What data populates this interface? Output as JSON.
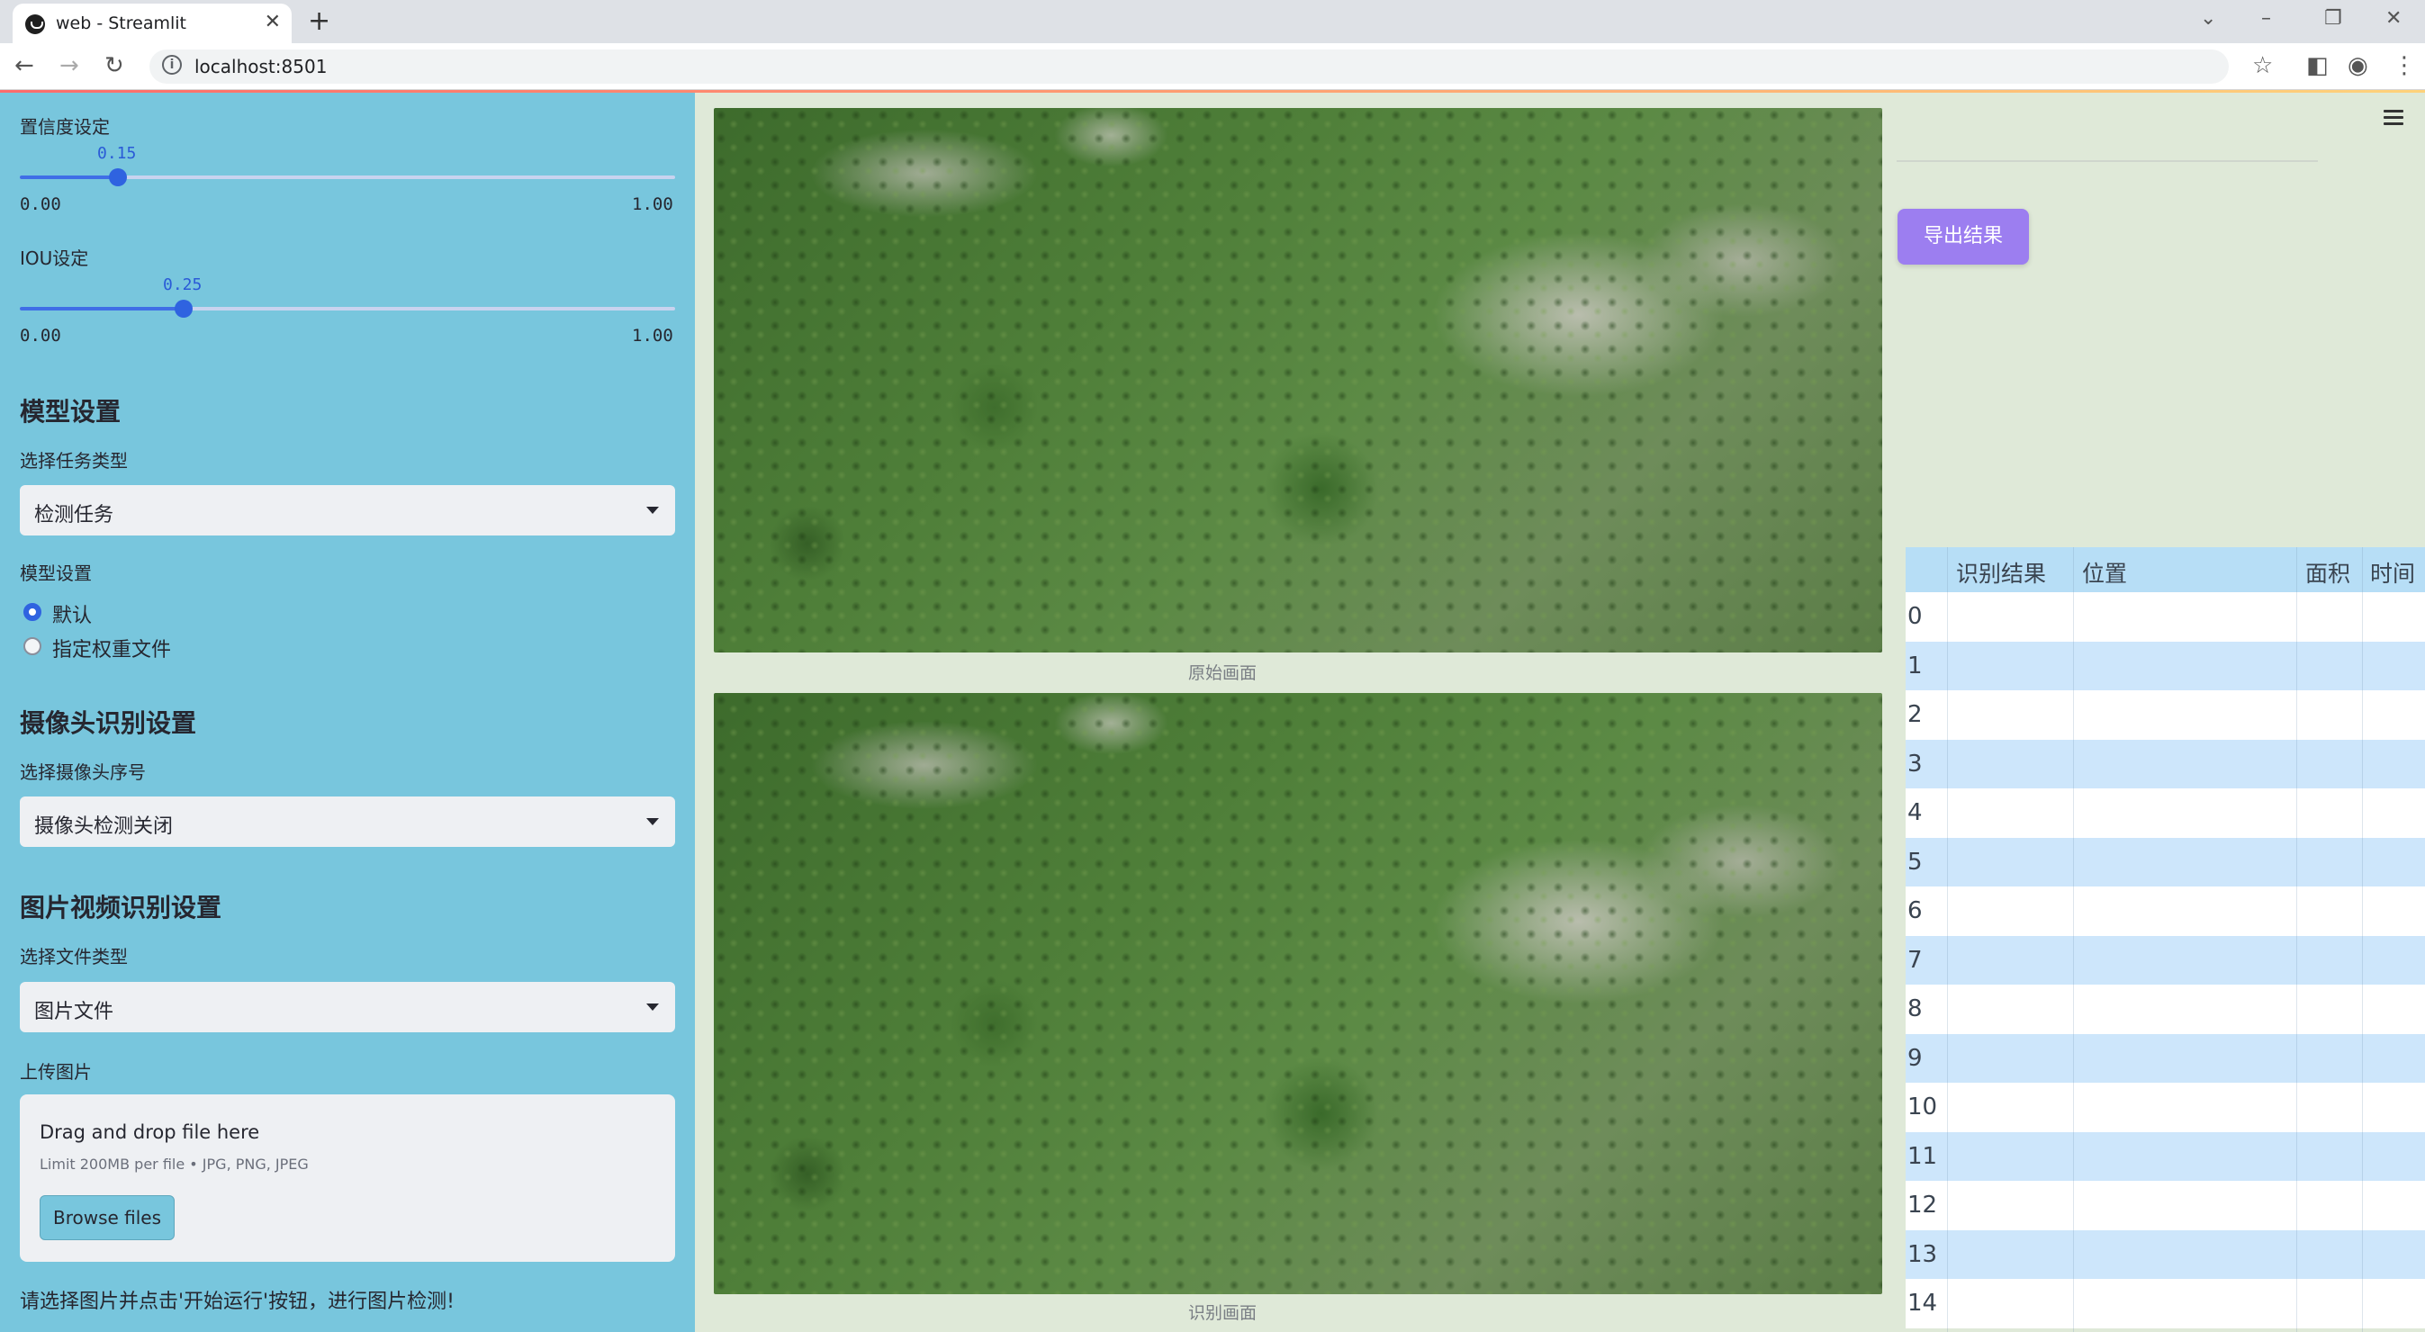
{
  "browser": {
    "tab_title": "web - Streamlit",
    "tab_close": "✕",
    "new_tab": "+",
    "url": "localhost:8501",
    "icons": [
      "back-icon",
      "forward-icon",
      "reload-icon",
      "star-icon",
      "sidebar-icon",
      "profile-icon",
      "kebab-icon"
    ]
  },
  "sidebar": {
    "conf_label": "置信度设定",
    "conf_value": "0.15",
    "conf_fraction": 0.15,
    "iou_label": "IOU设定",
    "iou_value": "0.25",
    "iou_fraction": 0.25,
    "slider_min": "0.00",
    "slider_max": "1.00",
    "model_section": "模型设置",
    "task_label": "选择任务类型",
    "task_value": "检测任务",
    "model_label": "模型设置",
    "radio_default": "默认",
    "radio_custom": "指定权重文件",
    "camera_section": "摄像头识别设置",
    "camera_label": "选择摄像头序号",
    "camera_value": "摄像头检测关闭",
    "file_section": "图片视频识别设置",
    "filetype_label": "选择文件类型",
    "filetype_value": "图片文件",
    "upload_label": "上传图片",
    "upload_title": "Drag and drop file here",
    "upload_limit": "Limit 200MB per file • JPG, PNG, JPEG",
    "browse_label": "Browse files",
    "hint": "请选择图片并点击'开始运行'按钮，进行图片检测!"
  },
  "main": {
    "caption_original": "原始画面",
    "caption_result": "识别画面",
    "export_label": "导出结果"
  },
  "table": {
    "headers": [
      "识别结果",
      "位置",
      "面积",
      "时间"
    ],
    "rows": [
      "0",
      "1",
      "2",
      "3",
      "4",
      "5",
      "6",
      "7",
      "8",
      "9",
      "10",
      "11",
      "12",
      "13",
      "14"
    ]
  },
  "colors": {
    "sidebar_bg": "#78c6dd",
    "main_bg": "#dfe9d8",
    "accent": "#2f63e0",
    "export_button": "#9c7ef0"
  }
}
